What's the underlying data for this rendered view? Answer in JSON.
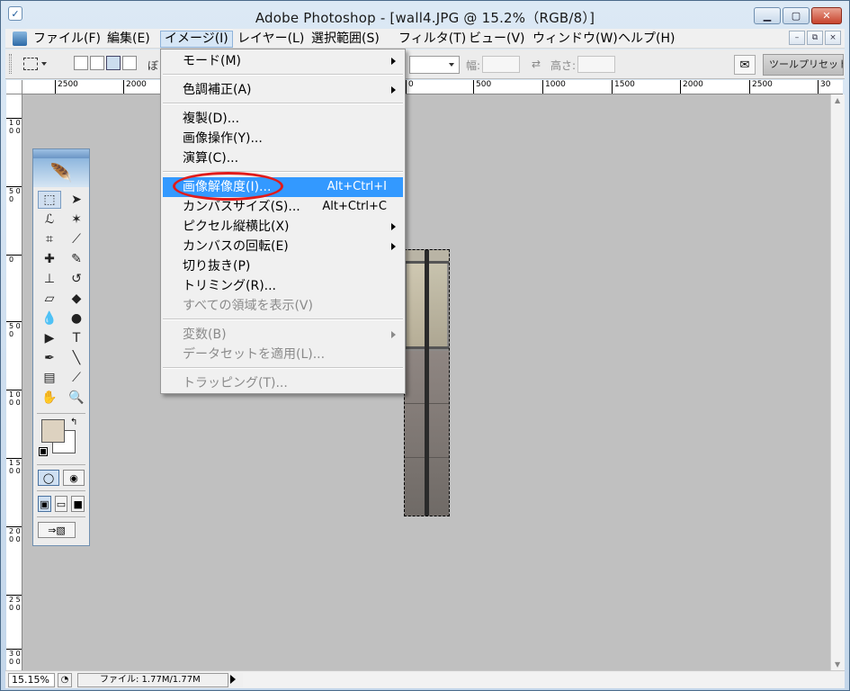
{
  "window": {
    "title": "Adobe Photoshop - [wall4.JPG @ 15.2%（RGB/8）]",
    "minimize_glyph": "▁",
    "maximize_glyph": "▢",
    "close_glyph": "✕"
  },
  "menubar": {
    "items": [
      {
        "label": "ファイル(F)"
      },
      {
        "label": "編集(E)"
      },
      {
        "label": "イメージ(I)"
      },
      {
        "label": "レイヤー(L)"
      },
      {
        "label": "選択範囲(S)"
      },
      {
        "label": "フィルタ(T)"
      },
      {
        "label": "ビュー(V)"
      },
      {
        "label": "ウィンドウ(W)"
      },
      {
        "label": "ヘルプ(H)"
      }
    ],
    "active_index": 2,
    "mdi_minimize": "–",
    "mdi_restore": "⧉",
    "mdi_close": "×"
  },
  "options": {
    "feather_fragment": "ぼ",
    "width_label": "幅:",
    "height_label": "高さ:",
    "swap_glyph": "⇄",
    "preset_tab": "ツールプリセット"
  },
  "rulers": {
    "top": [
      "2500",
      "2000",
      "1500",
      "1000",
      "500",
      "0",
      "500",
      "1000",
      "1500",
      "2000",
      "2500",
      "30"
    ],
    "left": [
      "1 0 0 0",
      "5 0 0",
      "0",
      "5 0 0",
      "1 0 0 0",
      "1 5 0 0",
      "2 0 0 0",
      "2 5 0 0",
      "3 0 0 0"
    ]
  },
  "image_menu": {
    "items": [
      {
        "label": "モード(M)",
        "shortcut": "",
        "submenu": true,
        "disabled": false
      },
      {
        "label": "色調補正(A)",
        "shortcut": "",
        "submenu": true,
        "disabled": false
      },
      {
        "label": "複製(D)...",
        "shortcut": "",
        "submenu": false,
        "disabled": false
      },
      {
        "label": "画像操作(Y)...",
        "shortcut": "",
        "submenu": false,
        "disabled": false
      },
      {
        "label": "演算(C)...",
        "shortcut": "",
        "submenu": false,
        "disabled": false
      },
      {
        "label": "画像解像度(I)...",
        "shortcut": "Alt+Ctrl+I",
        "submenu": false,
        "disabled": false,
        "highlighted": true
      },
      {
        "label": "カンバスサイズ(S)...",
        "shortcut": "Alt+Ctrl+C",
        "submenu": false,
        "disabled": false
      },
      {
        "label": "ピクセル縦横比(X)",
        "shortcut": "",
        "submenu": true,
        "disabled": false
      },
      {
        "label": "カンバスの回転(E)",
        "shortcut": "",
        "submenu": true,
        "disabled": false
      },
      {
        "label": "切り抜き(P)",
        "shortcut": "",
        "submenu": false,
        "disabled": false
      },
      {
        "label": "トリミング(R)...",
        "shortcut": "",
        "submenu": false,
        "disabled": false
      },
      {
        "label": "すべての領域を表示(V)",
        "shortcut": "",
        "submenu": false,
        "disabled": true
      },
      {
        "label": "変数(B)",
        "shortcut": "",
        "submenu": true,
        "disabled": true
      },
      {
        "label": "データセットを適用(L)...",
        "shortcut": "",
        "submenu": false,
        "disabled": true
      },
      {
        "label": "トラッピング(T)...",
        "shortcut": "",
        "submenu": false,
        "disabled": true
      }
    ]
  },
  "toolbox": {
    "tools": [
      {
        "name": "rect-marquee-tool-icon",
        "glyph": "⬚"
      },
      {
        "name": "move-tool-icon",
        "glyph": "➤"
      },
      {
        "name": "lasso-tool-icon",
        "glyph": "ℒ"
      },
      {
        "name": "magic-wand-tool-icon",
        "glyph": "✶"
      },
      {
        "name": "crop-tool-icon",
        "glyph": "⌗"
      },
      {
        "name": "slice-tool-icon",
        "glyph": "⟋"
      },
      {
        "name": "healing-brush-tool-icon",
        "glyph": "✚"
      },
      {
        "name": "brush-tool-icon",
        "glyph": "✎"
      },
      {
        "name": "clone-stamp-tool-icon",
        "glyph": "⊥"
      },
      {
        "name": "history-brush-tool-icon",
        "glyph": "↺"
      },
      {
        "name": "eraser-tool-icon",
        "glyph": "▱"
      },
      {
        "name": "paint-bucket-tool-icon",
        "glyph": "◆"
      },
      {
        "name": "blur-tool-icon",
        "glyph": "💧"
      },
      {
        "name": "dodge-tool-icon",
        "glyph": "●"
      },
      {
        "name": "path-select-tool-icon",
        "glyph": "▶"
      },
      {
        "name": "type-tool-icon",
        "glyph": "T"
      },
      {
        "name": "pen-tool-icon",
        "glyph": "✒"
      },
      {
        "name": "line-tool-icon",
        "glyph": "╲"
      },
      {
        "name": "notes-tool-icon",
        "glyph": "▤"
      },
      {
        "name": "eyedropper-tool-icon",
        "glyph": "⟋"
      },
      {
        "name": "hand-tool-icon",
        "glyph": "✋"
      },
      {
        "name": "zoom-tool-icon",
        "glyph": "🔍"
      }
    ],
    "foreground_color": "#ddd2c0",
    "background_color": "#ffffff",
    "swap_glyph": "↰"
  },
  "statusbar": {
    "zoom": "15.15%",
    "file_info": "ファイル: 1.77M/1.77M"
  }
}
